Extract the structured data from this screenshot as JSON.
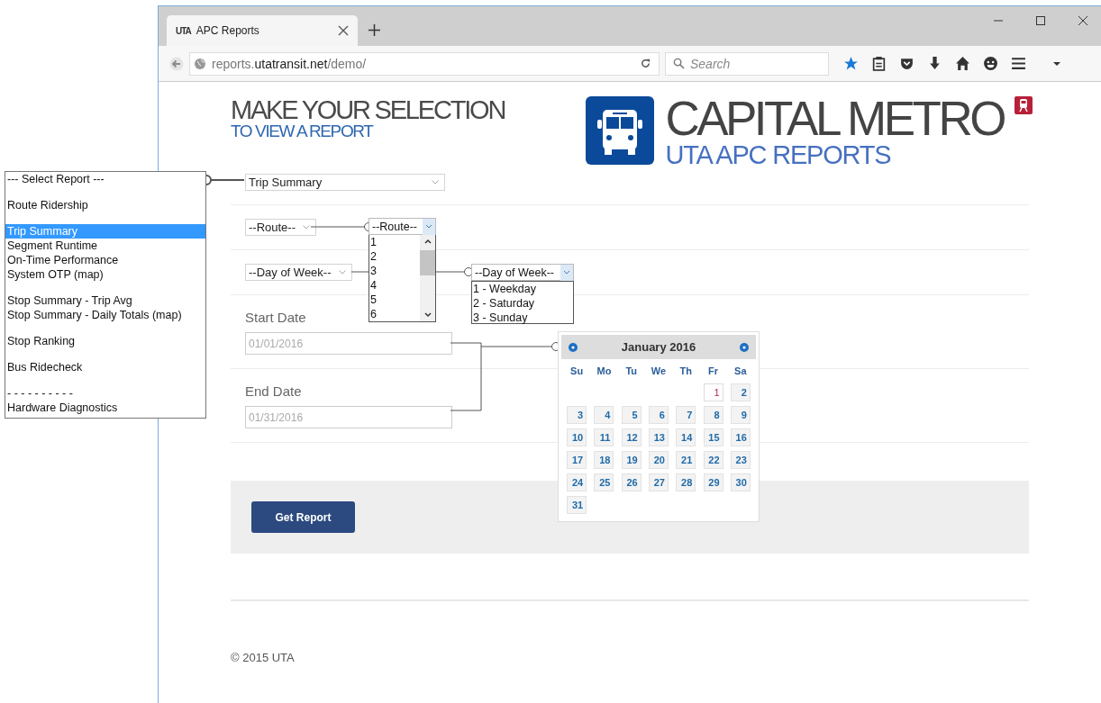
{
  "browser": {
    "tab_title": "APC Reports",
    "tab_logo": "UTA",
    "address": {
      "prefix": "reports.",
      "host": "utatransit.net",
      "path": "/demo/"
    },
    "search_placeholder": "Search"
  },
  "header": {
    "title": "MAKE YOUR SELECTION",
    "subtitle": "TO VIEW A REPORT",
    "brand": "CAPITAL METRO",
    "brand_subtitle": "UTA APC REPORTS"
  },
  "form": {
    "report_select": "Trip Summary",
    "route_select": "--Route--",
    "day_select": "--Day of Week--",
    "start_date": {
      "label": "Start Date",
      "value": "01/01/2016"
    },
    "end_date": {
      "label": "End Date",
      "value": "01/31/2016"
    },
    "submit": "Get Report"
  },
  "report_groups": [
    [
      {
        "label": "--- Select Report ---",
        "selected": false
      }
    ],
    [
      {
        "label": "Route Ridership",
        "selected": false
      }
    ],
    [
      {
        "label": "Trip Summary",
        "selected": true
      },
      {
        "label": "Segment Runtime",
        "selected": false
      },
      {
        "label": "On-Time Performance",
        "selected": false
      },
      {
        "label": "System OTP (map)",
        "selected": false
      }
    ],
    [
      {
        "label": "Stop Summary - Trip Avg",
        "selected": false
      },
      {
        "label": "Stop Summary - Daily Totals (map)",
        "selected": false
      }
    ],
    [
      {
        "label": "Stop Ranking",
        "selected": false
      }
    ],
    [
      {
        "label": "Bus Ridecheck",
        "selected": false
      }
    ],
    [
      {
        "label": "- - - - - - - - - -",
        "selected": false
      },
      {
        "label": "Hardware Diagnostics",
        "selected": false
      }
    ]
  ],
  "route_list": {
    "label": "--Route--",
    "options": [
      "1",
      "2",
      "3",
      "4",
      "5",
      "6"
    ]
  },
  "day_list": {
    "label": "--Day of Week--",
    "options": [
      "1 - Weekday",
      "2 - Saturday",
      "3 - Sunday"
    ]
  },
  "calendar": {
    "title": "January 2016",
    "weekdays": [
      "Su",
      "Mo",
      "Tu",
      "We",
      "Th",
      "Fr",
      "Sa"
    ],
    "weeks": [
      [
        {
          "day": "1",
          "today": true
        },
        {
          "day": "2",
          "today": false
        }
      ],
      [
        {
          "day": "3",
          "today": false
        },
        {
          "day": "4",
          "today": false
        },
        {
          "day": "5",
          "today": false
        },
        {
          "day": "6",
          "today": false
        },
        {
          "day": "7",
          "today": false
        },
        {
          "day": "8",
          "today": false
        },
        {
          "day": "9",
          "today": false
        }
      ],
      [
        {
          "day": "10",
          "today": false
        },
        {
          "day": "11",
          "today": false
        },
        {
          "day": "12",
          "today": false
        },
        {
          "day": "13",
          "today": false
        },
        {
          "day": "14",
          "today": false
        },
        {
          "day": "15",
          "today": false
        },
        {
          "day": "16",
          "today": false
        }
      ],
      [
        {
          "day": "17",
          "today": false
        },
        {
          "day": "18",
          "today": false
        },
        {
          "day": "19",
          "today": false
        },
        {
          "day": "20",
          "today": false
        },
        {
          "day": "21",
          "today": false
        },
        {
          "day": "22",
          "today": false
        },
        {
          "day": "23",
          "today": false
        }
      ],
      [
        {
          "day": "24",
          "today": false
        },
        {
          "day": "25",
          "today": false
        },
        {
          "day": "26",
          "today": false
        },
        {
          "day": "27",
          "today": false
        },
        {
          "day": "28",
          "today": false
        },
        {
          "day": "29",
          "today": false
        },
        {
          "day": "30",
          "today": false
        }
      ],
      [
        {
          "day": "31",
          "today": false
        }
      ]
    ]
  },
  "footer": "© 2015 UTA"
}
